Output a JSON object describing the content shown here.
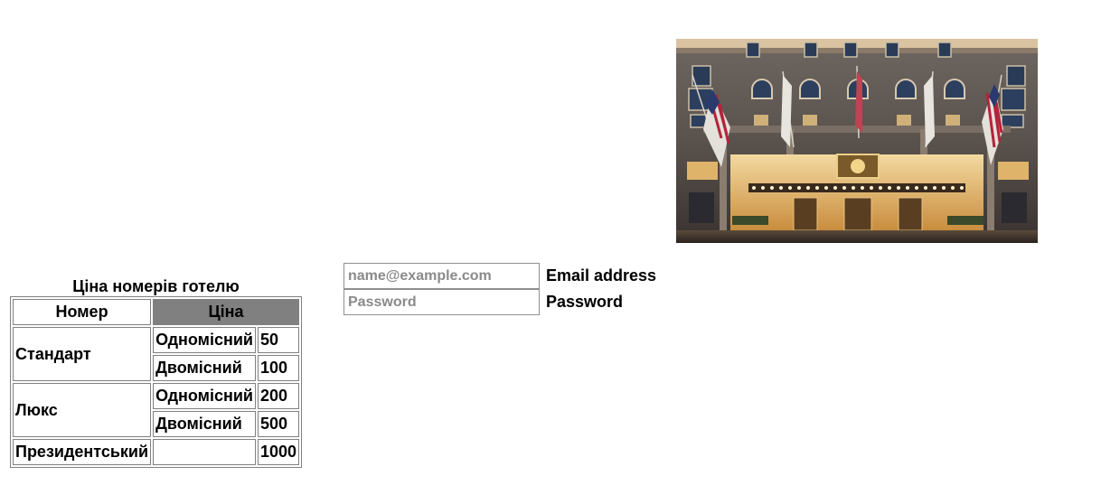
{
  "hotel_image": {
    "alt": "Hotel facade"
  },
  "price_table": {
    "caption": "Ціна номерів готелю",
    "headers": [
      "Номер",
      "Ціна"
    ],
    "rows": [
      {
        "room": "Стандарт",
        "options": [
          {
            "type": "Одномісний",
            "price": "50"
          },
          {
            "type": "Двомісний",
            "price": "100"
          }
        ]
      },
      {
        "room": "Люкс",
        "options": [
          {
            "type": "Одномісний",
            "price": "200"
          },
          {
            "type": "Двомісний",
            "price": "500"
          }
        ]
      },
      {
        "room": "Президентський",
        "options": [
          {
            "type": "",
            "price": "1000"
          }
        ]
      }
    ],
    "header_highlight_color": "#808080"
  },
  "form": {
    "email": {
      "placeholder": "name@example.com",
      "value": "",
      "label": "Email address"
    },
    "password": {
      "placeholder": "Password",
      "value": "",
      "label": "Password"
    }
  }
}
